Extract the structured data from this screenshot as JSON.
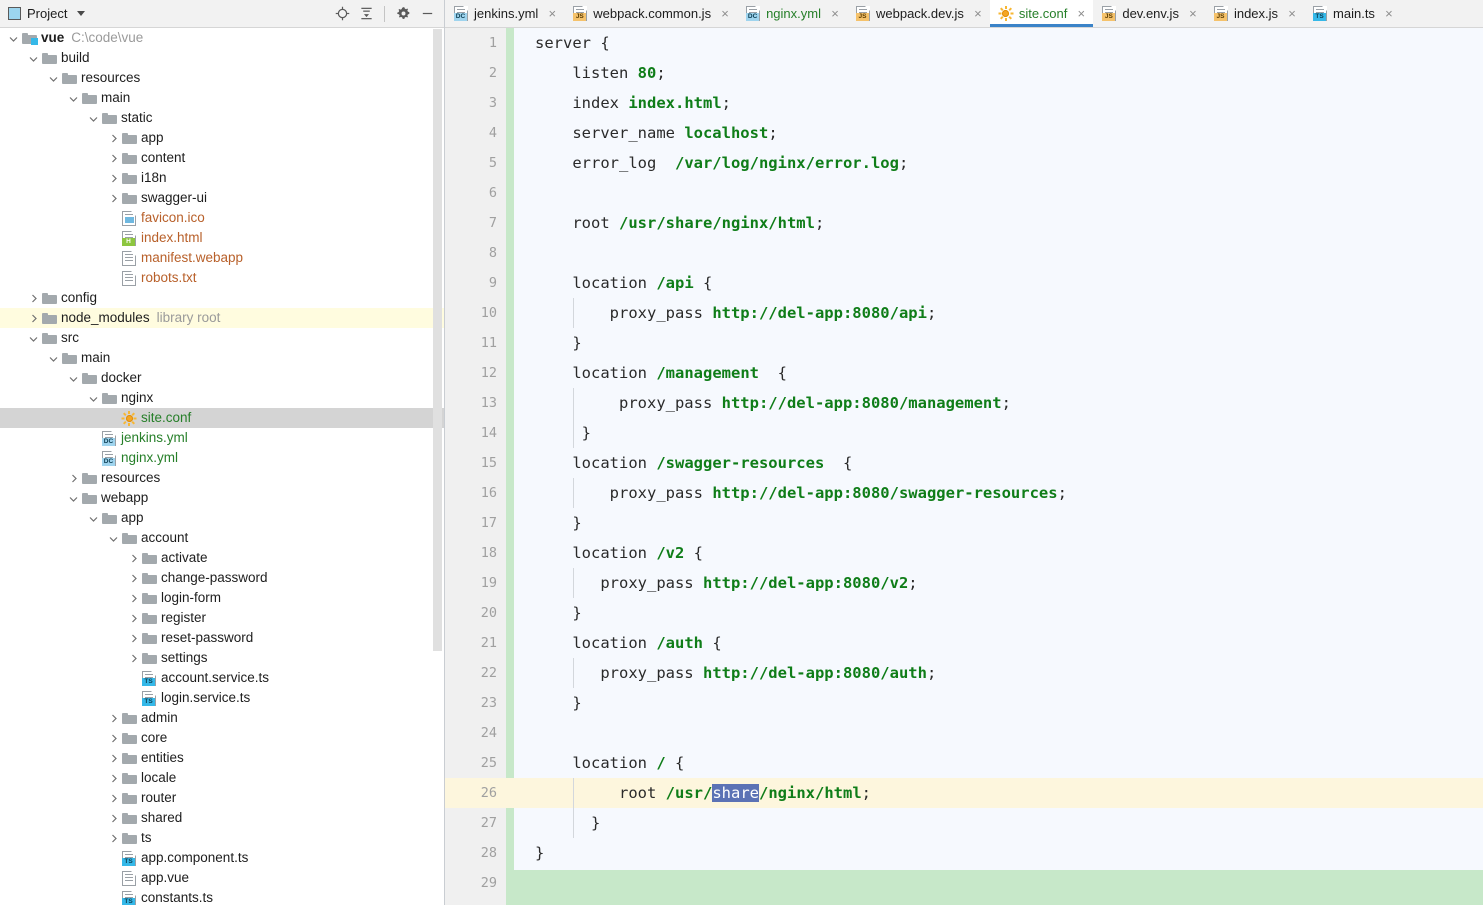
{
  "panel": {
    "title": "Project",
    "icons": {
      "dropdown": "chevron-down-icon",
      "locate": "locate-target-icon",
      "collapse": "collapse-all-icon",
      "settings": "gear-icon",
      "minimize": "minimize-icon"
    }
  },
  "tree": [
    {
      "depth": 0,
      "arrow": "down",
      "icon": "folder-module",
      "label": "vue",
      "bold": true,
      "suffix": "C:\\code\\vue",
      "state": "normal"
    },
    {
      "depth": 1,
      "arrow": "down",
      "icon": "folder",
      "label": "build",
      "state": "normal"
    },
    {
      "depth": 2,
      "arrow": "down",
      "icon": "folder",
      "label": "resources",
      "state": "normal"
    },
    {
      "depth": 3,
      "arrow": "down",
      "icon": "folder",
      "label": "main",
      "state": "normal"
    },
    {
      "depth": 4,
      "arrow": "down",
      "icon": "folder",
      "label": "static",
      "state": "normal"
    },
    {
      "depth": 5,
      "arrow": "right",
      "icon": "folder",
      "label": "app",
      "state": "normal"
    },
    {
      "depth": 5,
      "arrow": "right",
      "icon": "folder",
      "label": "content",
      "state": "normal"
    },
    {
      "depth": 5,
      "arrow": "right",
      "icon": "folder",
      "label": "i18n",
      "state": "normal"
    },
    {
      "depth": 5,
      "arrow": "right",
      "icon": "folder",
      "label": "swagger-ui",
      "state": "normal"
    },
    {
      "depth": 5,
      "arrow": "none",
      "icon": "file-image",
      "label": "favicon.ico",
      "color": "orange"
    },
    {
      "depth": 5,
      "arrow": "none",
      "icon": "file-html",
      "label": "index.html",
      "color": "orange"
    },
    {
      "depth": 5,
      "arrow": "none",
      "icon": "file-plain",
      "label": "manifest.webapp",
      "color": "orange"
    },
    {
      "depth": 5,
      "arrow": "none",
      "icon": "file-plain",
      "label": "robots.txt",
      "color": "orange"
    },
    {
      "depth": 1,
      "arrow": "right",
      "icon": "folder",
      "label": "config",
      "state": "normal"
    },
    {
      "depth": 1,
      "arrow": "right",
      "icon": "folder",
      "label": "node_modules",
      "suffix": "library root",
      "state": "library"
    },
    {
      "depth": 1,
      "arrow": "down",
      "icon": "folder",
      "label": "src",
      "state": "normal"
    },
    {
      "depth": 2,
      "arrow": "down",
      "icon": "folder",
      "label": "main",
      "state": "normal"
    },
    {
      "depth": 3,
      "arrow": "down",
      "icon": "folder",
      "label": "docker",
      "state": "normal"
    },
    {
      "depth": 4,
      "arrow": "down",
      "icon": "folder",
      "label": "nginx",
      "state": "normal"
    },
    {
      "depth": 5,
      "arrow": "none",
      "icon": "file-conf",
      "label": "site.conf",
      "color": "green",
      "state": "selected"
    },
    {
      "depth": 4,
      "arrow": "none",
      "icon": "file-dc",
      "label": "jenkins.yml",
      "color": "green"
    },
    {
      "depth": 4,
      "arrow": "none",
      "icon": "file-dc",
      "label": "nginx.yml",
      "color": "green"
    },
    {
      "depth": 3,
      "arrow": "right",
      "icon": "folder",
      "label": "resources",
      "state": "normal"
    },
    {
      "depth": 3,
      "arrow": "down",
      "icon": "folder",
      "label": "webapp",
      "state": "normal"
    },
    {
      "depth": 4,
      "arrow": "down",
      "icon": "folder",
      "label": "app",
      "state": "normal"
    },
    {
      "depth": 5,
      "arrow": "down",
      "icon": "folder",
      "label": "account",
      "state": "normal"
    },
    {
      "depth": 6,
      "arrow": "right",
      "icon": "folder",
      "label": "activate",
      "state": "normal"
    },
    {
      "depth": 6,
      "arrow": "right",
      "icon": "folder",
      "label": "change-password",
      "state": "normal"
    },
    {
      "depth": 6,
      "arrow": "right",
      "icon": "folder",
      "label": "login-form",
      "state": "normal"
    },
    {
      "depth": 6,
      "arrow": "right",
      "icon": "folder",
      "label": "register",
      "state": "normal"
    },
    {
      "depth": 6,
      "arrow": "right",
      "icon": "folder",
      "label": "reset-password",
      "state": "normal"
    },
    {
      "depth": 6,
      "arrow": "right",
      "icon": "folder",
      "label": "settings",
      "state": "normal"
    },
    {
      "depth": 6,
      "arrow": "none",
      "icon": "file-ts",
      "label": "account.service.ts"
    },
    {
      "depth": 6,
      "arrow": "none",
      "icon": "file-ts",
      "label": "login.service.ts"
    },
    {
      "depth": 5,
      "arrow": "right",
      "icon": "folder",
      "label": "admin",
      "state": "normal"
    },
    {
      "depth": 5,
      "arrow": "right",
      "icon": "folder",
      "label": "core",
      "state": "normal"
    },
    {
      "depth": 5,
      "arrow": "right",
      "icon": "folder",
      "label": "entities",
      "state": "normal"
    },
    {
      "depth": 5,
      "arrow": "right",
      "icon": "folder",
      "label": "locale",
      "state": "normal"
    },
    {
      "depth": 5,
      "arrow": "right",
      "icon": "folder",
      "label": "router",
      "state": "normal"
    },
    {
      "depth": 5,
      "arrow": "right",
      "icon": "folder",
      "label": "shared",
      "state": "normal"
    },
    {
      "depth": 5,
      "arrow": "right",
      "icon": "folder",
      "label": "ts",
      "state": "normal"
    },
    {
      "depth": 5,
      "arrow": "none",
      "icon": "file-ts",
      "label": "app.component.ts"
    },
    {
      "depth": 5,
      "arrow": "none",
      "icon": "file-plain",
      "label": "app.vue"
    },
    {
      "depth": 5,
      "arrow": "none",
      "icon": "file-ts",
      "label": "constants.ts"
    }
  ],
  "tabs": [
    {
      "label": "jenkins.yml",
      "icon": "file-dc",
      "active": false,
      "green": false
    },
    {
      "label": "webpack.common.js",
      "icon": "file-js",
      "active": false,
      "green": false
    },
    {
      "label": "nginx.yml",
      "icon": "file-dc",
      "active": false,
      "green": true
    },
    {
      "label": "webpack.dev.js",
      "icon": "file-js",
      "active": false,
      "green": false
    },
    {
      "label": "site.conf",
      "icon": "file-conf",
      "active": true,
      "green": true
    },
    {
      "label": "dev.env.js",
      "icon": "file-js",
      "active": false,
      "green": false
    },
    {
      "label": "index.js",
      "icon": "file-js",
      "active": false,
      "green": false
    },
    {
      "label": "main.ts",
      "icon": "file-ts",
      "active": false,
      "green": false
    }
  ],
  "editor": {
    "active_file": "site.conf",
    "current_line": 26,
    "selection_text": "share",
    "total_lines": 29,
    "accent_tab_underline": "#3b83c8",
    "selection_bg": "#5b72b5",
    "current_line_bg": "#fdf6dd",
    "gutter_stripe": "#c7e8c9",
    "lines": [
      {
        "n": 1,
        "indent": 0,
        "tokens": [
          {
            "t": "server ",
            "c": "kw"
          },
          {
            "t": "{",
            "c": "punc"
          }
        ]
      },
      {
        "n": 2,
        "indent": 1,
        "tokens": [
          {
            "t": "    listen ",
            "c": "kw"
          },
          {
            "t": "80",
            "c": "num"
          },
          {
            "t": ";",
            "c": "punc"
          }
        ]
      },
      {
        "n": 3,
        "indent": 1,
        "tokens": [
          {
            "t": "    index ",
            "c": "kw"
          },
          {
            "t": "index.html",
            "c": "val"
          },
          {
            "t": ";",
            "c": "punc"
          }
        ]
      },
      {
        "n": 4,
        "indent": 1,
        "tokens": [
          {
            "t": "    server_name ",
            "c": "kw"
          },
          {
            "t": "localhost",
            "c": "val"
          },
          {
            "t": ";",
            "c": "punc"
          }
        ]
      },
      {
        "n": 5,
        "indent": 1,
        "tokens": [
          {
            "t": "    error_log  ",
            "c": "kw"
          },
          {
            "t": "/var/log/nginx/error.log",
            "c": "val"
          },
          {
            "t": ";",
            "c": "punc"
          }
        ]
      },
      {
        "n": 6,
        "indent": 0,
        "tokens": []
      },
      {
        "n": 7,
        "indent": 1,
        "tokens": [
          {
            "t": "    root ",
            "c": "kw"
          },
          {
            "t": "/usr/share/nginx/html",
            "c": "val"
          },
          {
            "t": ";",
            "c": "punc"
          }
        ]
      },
      {
        "n": 8,
        "indent": 0,
        "tokens": []
      },
      {
        "n": 9,
        "indent": 1,
        "tokens": [
          {
            "t": "    location ",
            "c": "kw"
          },
          {
            "t": "/api",
            "c": "val"
          },
          {
            "t": " {",
            "c": "punc"
          }
        ]
      },
      {
        "n": 10,
        "indent": 2,
        "tokens": [
          {
            "t": "        proxy_pass ",
            "c": "kw"
          },
          {
            "t": "http://del-app:8080/api",
            "c": "val"
          },
          {
            "t": ";",
            "c": "punc"
          }
        ]
      },
      {
        "n": 11,
        "indent": 1,
        "tokens": [
          {
            "t": "    }",
            "c": "punc"
          }
        ]
      },
      {
        "n": 12,
        "indent": 1,
        "tokens": [
          {
            "t": "    location ",
            "c": "kw"
          },
          {
            "t": "/management",
            "c": "val"
          },
          {
            "t": "  {",
            "c": "punc"
          }
        ]
      },
      {
        "n": 13,
        "indent": 2,
        "tokens": [
          {
            "t": "         proxy_pass ",
            "c": "kw"
          },
          {
            "t": "http://del-app:8080/management",
            "c": "val"
          },
          {
            "t": ";",
            "c": "punc"
          }
        ]
      },
      {
        "n": 14,
        "indent": 2,
        "tokens": [
          {
            "t": "     }",
            "c": "punc"
          }
        ]
      },
      {
        "n": 15,
        "indent": 1,
        "tokens": [
          {
            "t": "    location ",
            "c": "kw"
          },
          {
            "t": "/swagger-resources",
            "c": "val"
          },
          {
            "t": "  {",
            "c": "punc"
          }
        ]
      },
      {
        "n": 16,
        "indent": 2,
        "tokens": [
          {
            "t": "        proxy_pass ",
            "c": "kw"
          },
          {
            "t": "http://del-app:8080/swagger-resources",
            "c": "val"
          },
          {
            "t": ";",
            "c": "punc"
          }
        ]
      },
      {
        "n": 17,
        "indent": 1,
        "tokens": [
          {
            "t": "    }",
            "c": "punc"
          }
        ]
      },
      {
        "n": 18,
        "indent": 1,
        "tokens": [
          {
            "t": "    location ",
            "c": "kw"
          },
          {
            "t": "/v2",
            "c": "val"
          },
          {
            "t": " {",
            "c": "punc"
          }
        ]
      },
      {
        "n": 19,
        "indent": 2,
        "tokens": [
          {
            "t": "       proxy_pass ",
            "c": "kw"
          },
          {
            "t": "http://del-app:8080/v2",
            "c": "val"
          },
          {
            "t": ";",
            "c": "punc"
          }
        ]
      },
      {
        "n": 20,
        "indent": 1,
        "tokens": [
          {
            "t": "    }",
            "c": "punc"
          }
        ]
      },
      {
        "n": 21,
        "indent": 1,
        "tokens": [
          {
            "t": "    location ",
            "c": "kw"
          },
          {
            "t": "/auth",
            "c": "val"
          },
          {
            "t": " {",
            "c": "punc"
          }
        ]
      },
      {
        "n": 22,
        "indent": 2,
        "tokens": [
          {
            "t": "       proxy_pass ",
            "c": "kw"
          },
          {
            "t": "http://del-app:8080/auth",
            "c": "val"
          },
          {
            "t": ";",
            "c": "punc"
          }
        ]
      },
      {
        "n": 23,
        "indent": 1,
        "tokens": [
          {
            "t": "    }",
            "c": "punc"
          }
        ]
      },
      {
        "n": 24,
        "indent": 0,
        "tokens": []
      },
      {
        "n": 25,
        "indent": 1,
        "tokens": [
          {
            "t": "    location ",
            "c": "kw"
          },
          {
            "t": "/",
            "c": "val"
          },
          {
            "t": " {",
            "c": "punc"
          }
        ]
      },
      {
        "n": 26,
        "indent": 2,
        "highlight": true,
        "tokens": [
          {
            "t": "         root ",
            "c": "kw"
          },
          {
            "t": "/usr/",
            "c": "val"
          },
          {
            "t": "share",
            "c": "sel"
          },
          {
            "t": "/nginx/html",
            "c": "val"
          },
          {
            "t": ";",
            "c": "punc"
          }
        ]
      },
      {
        "n": 27,
        "indent": 2,
        "tokens": [
          {
            "t": "      }",
            "c": "punc"
          }
        ]
      },
      {
        "n": 28,
        "indent": 0,
        "tokens": [
          {
            "t": "}",
            "c": "punc"
          }
        ]
      },
      {
        "n": 29,
        "indent": 0,
        "tokens": []
      }
    ]
  }
}
